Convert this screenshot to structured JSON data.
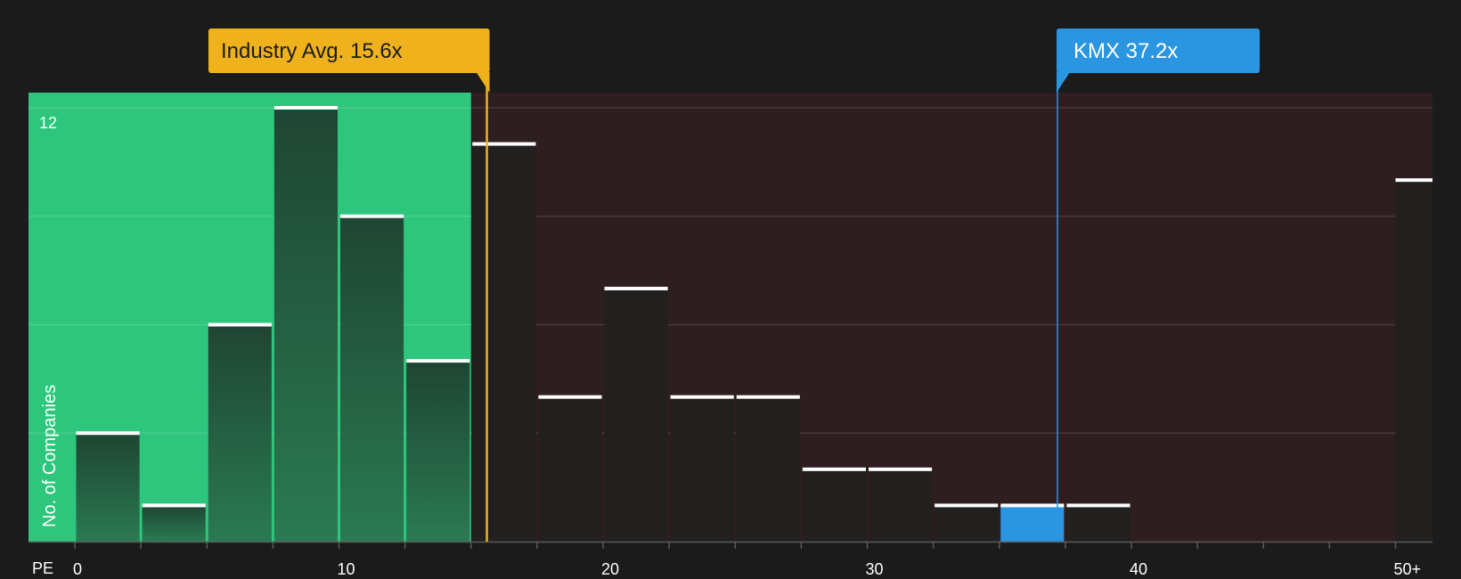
{
  "chart_data": {
    "type": "bar",
    "axis_prefix": "PE",
    "ylabel": "No. of Companies",
    "y_top_label": "12",
    "ylim": [
      0,
      12
    ],
    "bin_width": 2.5,
    "x_ticks": [
      {
        "value": 0,
        "label": "0"
      },
      {
        "value": 10,
        "label": "10"
      },
      {
        "value": 20,
        "label": "20"
      },
      {
        "value": 30,
        "label": "30"
      },
      {
        "value": 40,
        "label": "40"
      },
      {
        "value": 50,
        "label": "50+"
      }
    ],
    "bars": [
      {
        "x0": 0,
        "value": 3
      },
      {
        "x0": 2.5,
        "value": 1
      },
      {
        "x0": 5,
        "value": 6
      },
      {
        "x0": 7.5,
        "value": 12
      },
      {
        "x0": 10,
        "value": 9
      },
      {
        "x0": 12.5,
        "value": 5
      },
      {
        "x0": 15,
        "value": 11
      },
      {
        "x0": 17.5,
        "value": 4
      },
      {
        "x0": 20,
        "value": 7
      },
      {
        "x0": 22.5,
        "value": 4
      },
      {
        "x0": 25,
        "value": 4
      },
      {
        "x0": 27.5,
        "value": 2
      },
      {
        "x0": 30,
        "value": 2
      },
      {
        "x0": 32.5,
        "value": 1
      },
      {
        "x0": 35,
        "value": 1,
        "highlight": true
      },
      {
        "x0": 37.5,
        "value": 1
      },
      {
        "x0": 50,
        "value": 10
      }
    ],
    "industry_avg": {
      "value": 15.6,
      "label": "Industry Avg. 15.6x"
    },
    "company": {
      "value": 37.2,
      "label": "KMX 37.2x"
    },
    "colors": {
      "background": "#1b1b1b",
      "green_zone": "#2dc67c",
      "red_zone": "#2e1e1f",
      "bar_green_top": "#1f4533",
      "bar_green_bottom": "#2a7a52",
      "bar_dark": "#221f1f",
      "bar_highlight": "#2a95e0",
      "bar_cap": "#ffffff",
      "industry": "#f0b21c",
      "company": "#2a95e0"
    }
  }
}
